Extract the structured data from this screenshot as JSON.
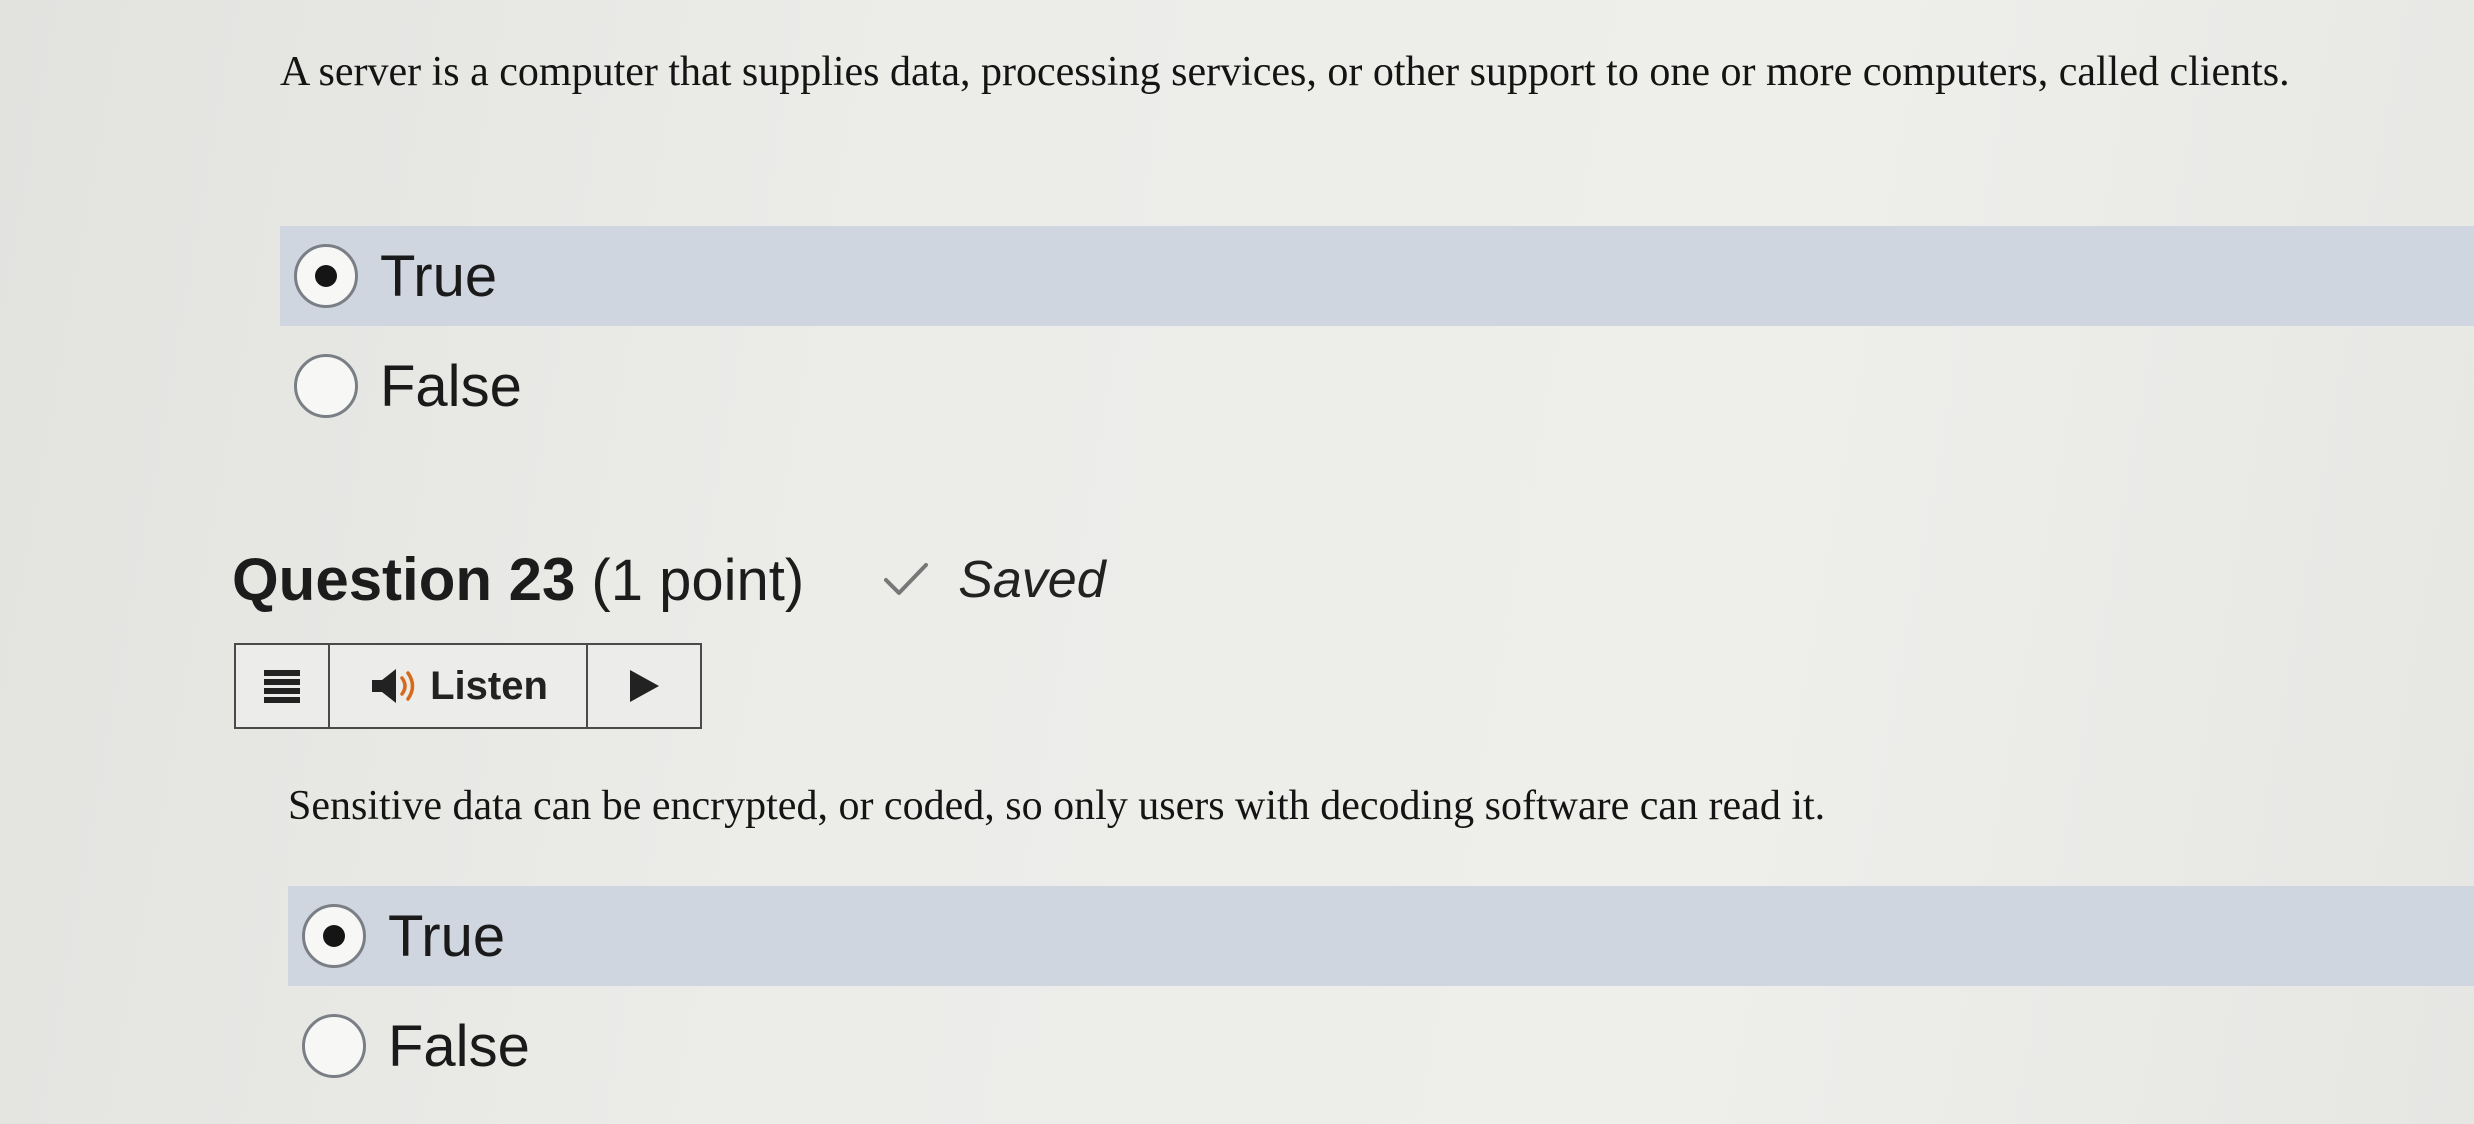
{
  "question22": {
    "text": "A server is a computer that supplies data, processing services, or other support to one or more computers, called clients.",
    "options": [
      {
        "label": "True",
        "selected": true
      },
      {
        "label": "False",
        "selected": false
      }
    ]
  },
  "question23": {
    "title": "Question 23",
    "points": "(1 point)",
    "status": "Saved",
    "listen_toolbar": {
      "menu_icon": "menu-icon",
      "speaker_icon": "speaker-icon",
      "listen_label": "Listen",
      "play_icon": "play-icon"
    },
    "text": "Sensitive data can be encrypted, or coded, so only users with decoding software can read it.",
    "options": [
      {
        "label": "True",
        "selected": true
      },
      {
        "label": "False",
        "selected": false
      }
    ]
  },
  "colors": {
    "selected_option_bg": "#cfd6df",
    "page_bg": "#ececea",
    "text": "#1a1a1a"
  }
}
